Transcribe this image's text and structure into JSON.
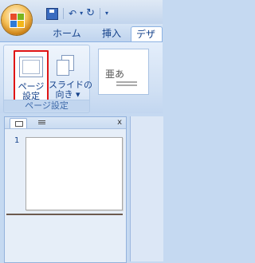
{
  "quick_access": {
    "save_icon": "save-icon",
    "undo_icon": "undo-icon",
    "redo_icon": "redo-icon",
    "customize_icon": "dropdown-arrow-icon"
  },
  "tabs": [
    {
      "label": "ホーム"
    },
    {
      "label": "挿入"
    },
    {
      "label": "デザイ"
    }
  ],
  "ribbon": {
    "page_setup_group": {
      "label": "ページ設定",
      "page_setup_button": "ページ\n設定",
      "slide_orientation_button": "スライドの\n向き ▾"
    },
    "themes_gallery": {
      "sample_text": "亜あ"
    }
  },
  "pane": {
    "close": "x",
    "slides": [
      {
        "number": "1"
      }
    ]
  },
  "colors": {
    "highlight": "#e01414",
    "ribbon_text": "#15428b"
  }
}
